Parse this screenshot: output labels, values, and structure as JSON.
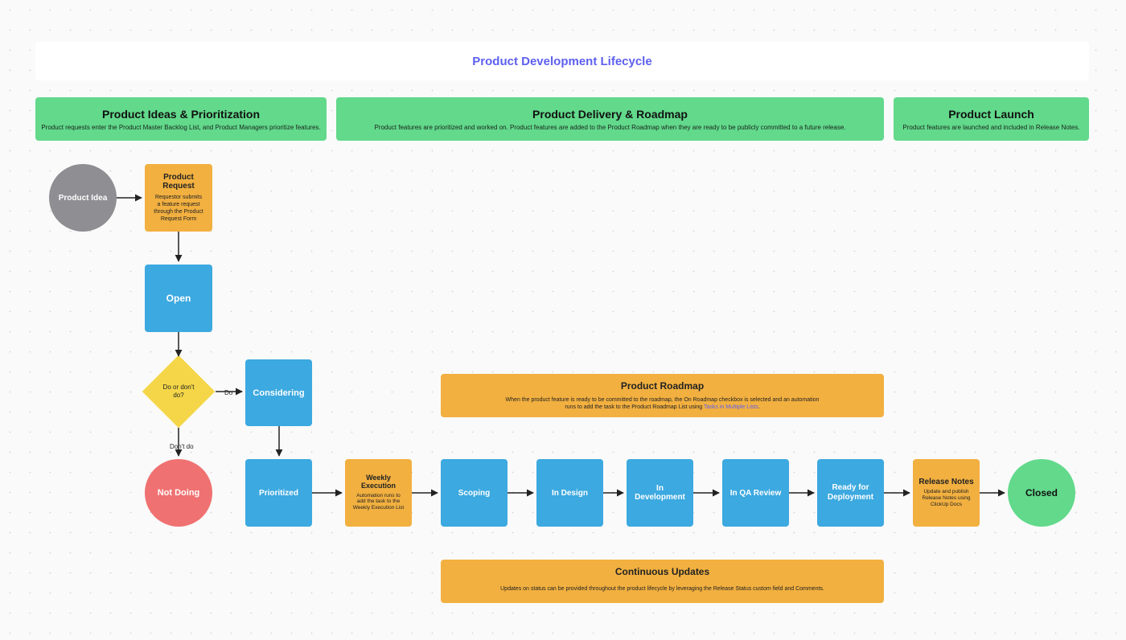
{
  "title": "Product Development Lifecycle",
  "phases": {
    "ideas": {
      "title": "Product Ideas & Prioritization",
      "desc": "Product requests enter the Product Master Backlog List, and Product Managers prioritize features."
    },
    "delivery": {
      "title": "Product Delivery & Roadmap",
      "desc": "Product features are prioritized and worked on. Product features are added to the Product Roadmap when they are ready to be publicly committed to a future release."
    },
    "launch": {
      "title": "Product Launch",
      "desc": "Product features are launched and included in Release Notes."
    }
  },
  "nodes": {
    "idea": "Product Idea",
    "request": {
      "title": "Product Request",
      "desc": "Requestor submits a feature request through the Product Request Form"
    },
    "open": "Open",
    "decision": "Do or don't do?",
    "considering": "Considering",
    "notdoing": "Not Doing",
    "prioritized": "Prioritized",
    "weekly": {
      "title": "Weekly Execution",
      "desc": "Automation runs to add the task to the Weekly Execution List"
    },
    "scoping": "Scoping",
    "indesign": "In Design",
    "indev": "In Development",
    "inqa": "In QA Review",
    "ready": "Ready for Deployment",
    "relnotes": {
      "title": "Release Notes",
      "desc": "Update and publish Release Notes using ClickUp Docs"
    },
    "closed": "Closed",
    "roadmap": {
      "title": "Product Roadmap",
      "desc": "When the product feature is ready to be committed to the roadmap, the On Roadmap checkbox is selected and an automation runs to add the task to the Product Roadmap List using ",
      "link": "Tasks in Multiple Lists"
    },
    "continuous": {
      "title": "Continuous Updates",
      "desc": "Updates on status can be provided throughout the product lifecycle by leveraging the Release Status custom field and Comments."
    }
  },
  "edge_labels": {
    "do": "Do",
    "dontdo": "Don't do"
  }
}
